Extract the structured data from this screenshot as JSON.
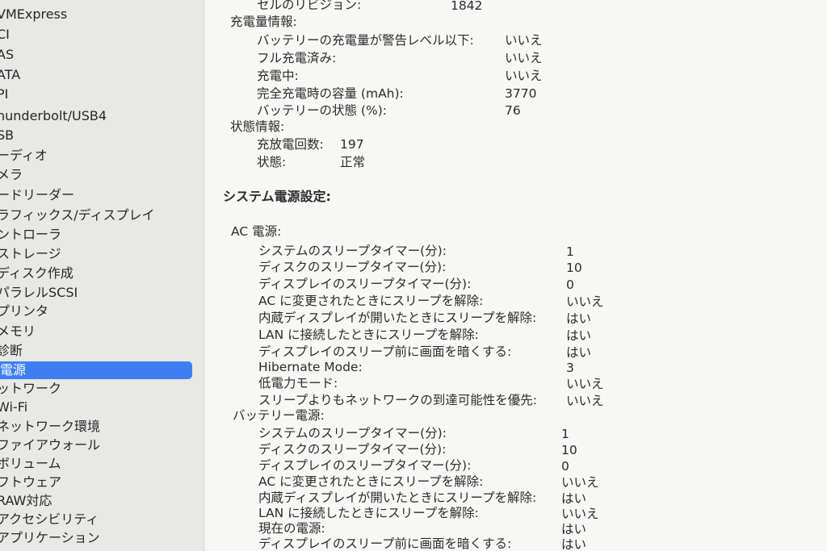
{
  "sidebar": {
    "items": [
      {
        "label": "VMExpress"
      },
      {
        "label": "CI"
      },
      {
        "label": "AS"
      },
      {
        "label": "ATA"
      },
      {
        "label": "PI"
      },
      {
        "label": "hunderbolt/USB4"
      },
      {
        "label": "SB"
      },
      {
        "label": "ーディオ"
      },
      {
        "label": "メラ"
      },
      {
        "label": "ードリーダー"
      },
      {
        "label": "ラフィックス/ディスプレイ"
      },
      {
        "label": "ントローラ"
      },
      {
        "label": "ストレージ"
      },
      {
        "label": "ディスク作成"
      },
      {
        "label": "パラレルSCSI"
      },
      {
        "label": "プリンタ"
      },
      {
        "label": "メモリ"
      },
      {
        "label": "診断"
      },
      {
        "label": "電源",
        "selected": true
      },
      {
        "label": "ットワーク"
      },
      {
        "label": "Wi-Fi"
      },
      {
        "label": "ネットワーク環境"
      },
      {
        "label": "ファイアウォール"
      },
      {
        "label": "ボリューム"
      },
      {
        "label": "フトウェア"
      },
      {
        "label": "RAW対応"
      },
      {
        "label": "アクセシビリティ"
      },
      {
        "label": "アプリケーション"
      }
    ]
  },
  "main": {
    "cell_revision": {
      "label": "セルのリビジョン:",
      "value": "1842"
    },
    "charge_info": {
      "heading": "充電量情報:",
      "rows": [
        {
          "label": "バッテリーの充電量が警告レベル以下:",
          "value": "いいえ"
        },
        {
          "label": "フル充電済み:",
          "value": "いいえ"
        },
        {
          "label": "充電中:",
          "value": "いいえ"
        },
        {
          "label": "完全充電時の容量 (mAh):",
          "value": "3770"
        },
        {
          "label": "バッテリーの状態 (%):",
          "value": "76"
        }
      ]
    },
    "status_info": {
      "heading": "状態情報:",
      "rows": [
        {
          "label": "充放電回数:",
          "value": "197"
        },
        {
          "label": "状態:",
          "value": "正常"
        }
      ]
    },
    "system_power_heading": "システム電源設定:",
    "ac_power": {
      "heading": "AC 電源:",
      "rows": [
        {
          "label": "システムのスリープタイマー(分):",
          "value": "1"
        },
        {
          "label": "ディスクのスリープタイマー(分):",
          "value": "10"
        },
        {
          "label": "ディスプレイのスリープタイマー(分):",
          "value": "0"
        },
        {
          "label": "AC に変更されたときにスリープを解除:",
          "value": "いいえ"
        },
        {
          "label": "内蔵ディスプレイが開いたときにスリープを解除:",
          "value": "はい"
        },
        {
          "label": "LAN に接続したときにスリープを解除:",
          "value": "はい"
        },
        {
          "label": "ディスプレイのスリープ前に画面を暗くする:",
          "value": "はい"
        },
        {
          "label": "Hibernate Mode:",
          "value": "3"
        },
        {
          "label": "低電力モード:",
          "value": "いいえ"
        },
        {
          "label": "スリープよりもネットワークの到達可能性を優先:",
          "value": "いいえ"
        }
      ]
    },
    "battery_power": {
      "heading": "バッテリー電源:",
      "rows": [
        {
          "label": "システムのスリープタイマー(分):",
          "value": "1"
        },
        {
          "label": "ディスクのスリープタイマー(分):",
          "value": "10"
        },
        {
          "label": "ディスプレイのスリープタイマー(分):",
          "value": "0"
        },
        {
          "label": "AC に変更されたときにスリープを解除:",
          "value": "いいえ"
        },
        {
          "label": "内蔵ディスプレイが開いたときにスリープを解除:",
          "value": "はい"
        },
        {
          "label": "LAN に接続したときにスリープを解除:",
          "value": "いいえ"
        },
        {
          "label": "現在の電源:",
          "value": "はい"
        },
        {
          "label": "ディスプレイのスリープ前に画面を暗くする:",
          "value": "はい"
        }
      ]
    }
  },
  "colors": {
    "selection": "#3d7ff1",
    "sidebar_bg": "#e8e8e6",
    "content_bg": "#f7f7f5"
  }
}
